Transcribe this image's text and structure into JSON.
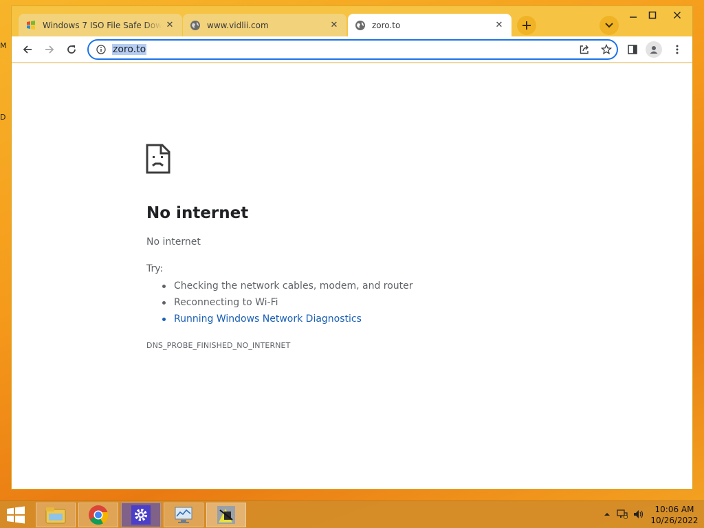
{
  "browser": {
    "tabs": [
      {
        "title": "Windows 7 ISO File Safe Downlo...",
        "favicon": "windows-favicon",
        "active": false
      },
      {
        "title": "www.vidlii.com",
        "favicon": "globe-icon",
        "active": false
      },
      {
        "title": "zoro.to",
        "favicon": "globe-icon",
        "active": true
      }
    ],
    "omnibox": {
      "url": "zoro.to"
    },
    "theme_color": "#f6c343",
    "accent_color": "#1a73e8"
  },
  "page": {
    "title": "No internet",
    "subtitle": "No internet",
    "try_label": "Try:",
    "suggestions": [
      "Checking the network cables, modem, and router",
      "Reconnecting to Wi-Fi",
      "Running Windows Network Diagnostics"
    ],
    "error_code": "DNS_PROBE_FINISHED_NO_INTERNET",
    "link_color": "#1a5fb4"
  },
  "desktop": {
    "edge_letters": [
      "M",
      "D"
    ]
  },
  "taskbar": {
    "items": [
      "file-explorer-icon",
      "chrome-icon",
      "settings-app-icon",
      "network-monitor-icon",
      "app-icon"
    ],
    "clock": {
      "time": "10:06 AM",
      "date": "10/26/2022"
    }
  }
}
